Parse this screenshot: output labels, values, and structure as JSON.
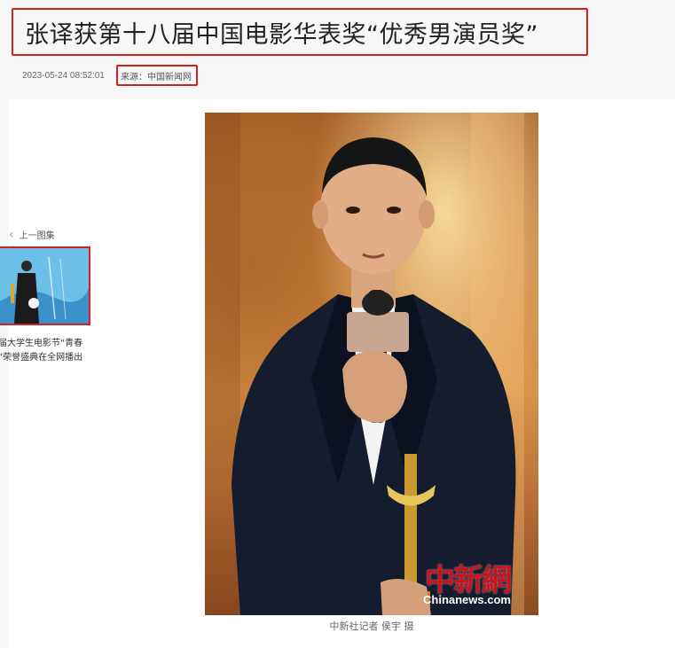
{
  "article": {
    "title": "张译获第十八届中国电影华表奖“优秀男演员奖”",
    "date": "2023-05-24 08:52:01",
    "source": "来源：中国新闻网"
  },
  "gallery": {
    "prev_label": "上一图集",
    "prev_caption_line1": "届大学生电影节“青春",
    "prev_caption_line2": "”荣誉盛典在全网播出"
  },
  "photo": {
    "credit": "中新社记者 侯宇 摄",
    "watermark_cn": "中新網",
    "watermark_en": "Chinanews.com"
  },
  "colors": {
    "highlight": "#d81e1e",
    "watermark_red": "#c8141c"
  }
}
